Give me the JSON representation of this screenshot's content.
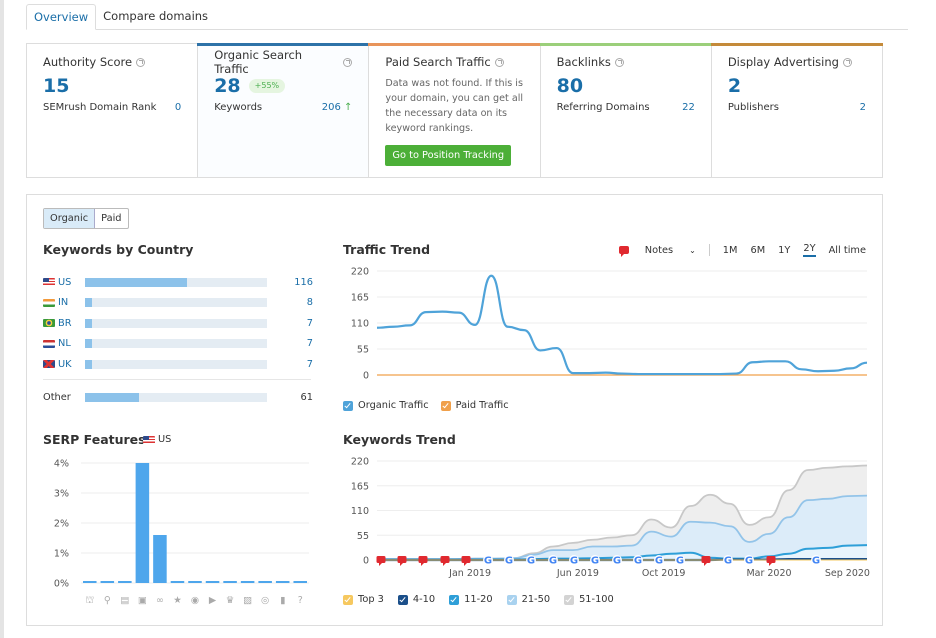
{
  "tabs": [
    {
      "label": "Overview",
      "active": true
    },
    {
      "label": "Compare domains",
      "active": false
    }
  ],
  "cards": {
    "authority": {
      "title": "Authority Score",
      "value": "15",
      "row_label": "SEMrush Domain Rank",
      "row_value": "0"
    },
    "organic": {
      "title": "Organic Search Traffic",
      "value": "28",
      "badge": "+55%",
      "row_label": "Keywords",
      "row_value": "206",
      "row_arrow": "↑",
      "accent": "#2d72a8"
    },
    "paid": {
      "title": "Paid Search Traffic",
      "message": "Data was not found. If this is your domain, you can get all the necessary data on its keyword rankings.",
      "button": "Go to Position Tracking",
      "accent": "#e8945a"
    },
    "backlinks": {
      "title": "Backlinks",
      "value": "80",
      "row_label": "Referring Domains",
      "row_value": "22",
      "accent": "#9bcf7a"
    },
    "display": {
      "title": "Display Advertising",
      "value": "2",
      "row_label": "Publishers",
      "row_value": "2",
      "accent": "#c48a3a"
    }
  },
  "toggle": {
    "organic": "Organic",
    "paid": "Paid",
    "selected": "Organic"
  },
  "keywords_by_country": {
    "title": "Keywords by Country",
    "max": 206,
    "rows": [
      {
        "code": "US",
        "value": 116
      },
      {
        "code": "IN",
        "value": 8
      },
      {
        "code": "BR",
        "value": 7
      },
      {
        "code": "NL",
        "value": 7
      },
      {
        "code": "UK",
        "value": 7
      }
    ],
    "other": {
      "label": "Other",
      "value": 61
    }
  },
  "traffic_trend": {
    "title": "Traffic Trend",
    "notes_label": "Notes",
    "periods": [
      "1M",
      "6M",
      "1Y",
      "2Y",
      "All time"
    ],
    "selected_period": "2Y",
    "legend": [
      {
        "label": "Organic Traffic",
        "color": "#4fa3d9"
      },
      {
        "label": "Paid Traffic",
        "color": "#f0a04b"
      }
    ]
  },
  "serp_features": {
    "title": "SERP Features",
    "country": "US",
    "icons": [
      "graduation-cap-icon",
      "map-pin-icon",
      "article-icon",
      "image-pack-icon",
      "link-icon",
      "star-icon",
      "video-play-icon",
      "video-icon",
      "crown-icon",
      "image-icon",
      "play-circle-icon",
      "knowledge-icon",
      "question-icon"
    ]
  },
  "keywords_trend": {
    "title": "Keywords Trend",
    "legend": [
      {
        "label": "Top 3",
        "color": "#f6c85f"
      },
      {
        "label": "4-10",
        "color": "#1b4f8a"
      },
      {
        "label": "11-20",
        "color": "#2e9fd8"
      },
      {
        "label": "21-50",
        "color": "#a9d2ef"
      },
      {
        "label": "51-100",
        "color": "#d3d3d3"
      }
    ]
  },
  "chart_data": [
    {
      "type": "line",
      "title": "Traffic Trend",
      "ylim": [
        0,
        220
      ],
      "yticks": [
        0,
        55,
        110,
        165,
        220
      ],
      "series": [
        {
          "name": "Organic Traffic",
          "values": [
            100,
            102,
            105,
            133,
            134,
            132,
            106,
            210,
            102,
            95,
            52,
            57,
            4,
            4,
            5,
            3,
            2,
            2,
            2,
            2,
            2,
            2,
            3,
            27,
            29,
            29,
            12,
            8,
            9,
            14,
            26
          ]
        },
        {
          "name": "Paid Traffic",
          "values": [
            0,
            0,
            0,
            0,
            0,
            0,
            0,
            0,
            0,
            0,
            0,
            0,
            0,
            0,
            0,
            0,
            0,
            0,
            0,
            0,
            0,
            0,
            0,
            0,
            0,
            0,
            0,
            0,
            0,
            0,
            0
          ]
        }
      ],
      "legend": "bottom-left",
      "grid": true
    },
    {
      "type": "bar",
      "title": "SERP Features",
      "categories": [
        "Featured snippet",
        "Local pack",
        "Top stories",
        "Image pack",
        "Sitelinks",
        "Reviews",
        "Video",
        "Featured video",
        "Top ads",
        "Images",
        "Video carousel",
        "Knowledge panel",
        "People also ask"
      ],
      "values": [
        0,
        0,
        0,
        4.0,
        1.6,
        0,
        0,
        0,
        0,
        0,
        0,
        0,
        0
      ],
      "ylim": [
        0,
        4
      ],
      "yticks": [
        "0%",
        "1%",
        "2%",
        "3%",
        "4%"
      ],
      "grid": true
    },
    {
      "type": "area",
      "title": "Keywords Trend",
      "ylim": [
        0,
        220
      ],
      "yticks": [
        0,
        55,
        110,
        165,
        220
      ],
      "xtick_labels": [
        "Jan 2019",
        "Jun 2019",
        "Oct 2019",
        "Mar 2020",
        "Sep 2020"
      ],
      "series": [
        {
          "name": "51-100",
          "values": [
            2,
            2,
            2,
            2,
            2,
            3,
            3,
            4,
            15,
            30,
            38,
            45,
            50,
            55,
            90,
            72,
            120,
            145,
            125,
            78,
            95,
            155,
            200,
            205,
            208,
            210
          ]
        },
        {
          "name": "21-50",
          "values": [
            2,
            2,
            2,
            2,
            2,
            3,
            3,
            4,
            12,
            22,
            22,
            30,
            30,
            32,
            63,
            52,
            85,
            83,
            75,
            40,
            58,
            95,
            133,
            136,
            142,
            143
          ]
        },
        {
          "name": "11-20",
          "values": [
            1,
            1,
            1,
            1,
            1,
            1,
            1,
            1,
            2,
            3,
            3,
            4,
            5,
            6,
            10,
            14,
            16,
            5,
            3,
            3,
            8,
            14,
            25,
            27,
            32,
            33
          ]
        },
        {
          "name": "4-10",
          "values": [
            0,
            0,
            0,
            0,
            0,
            0,
            0,
            0,
            0,
            0,
            0,
            0,
            0,
            0,
            0,
            0,
            0,
            0,
            1,
            1,
            1,
            2,
            2,
            2,
            2,
            2
          ]
        },
        {
          "name": "Top 3",
          "values": [
            0,
            0,
            0,
            0,
            0,
            0,
            0,
            0,
            0,
            0,
            0,
            0,
            0,
            0,
            0,
            0,
            0,
            0,
            0,
            0,
            0,
            0,
            0,
            0,
            0,
            0
          ]
        }
      ],
      "markers": [
        "note",
        "note",
        "note",
        "note",
        "note",
        "google",
        "google",
        "google",
        "google",
        "google",
        "google",
        "google",
        "google",
        "google",
        "google",
        "note",
        "google",
        "google",
        "note",
        "google"
      ],
      "legend": "bottom-left",
      "grid": true
    }
  ]
}
